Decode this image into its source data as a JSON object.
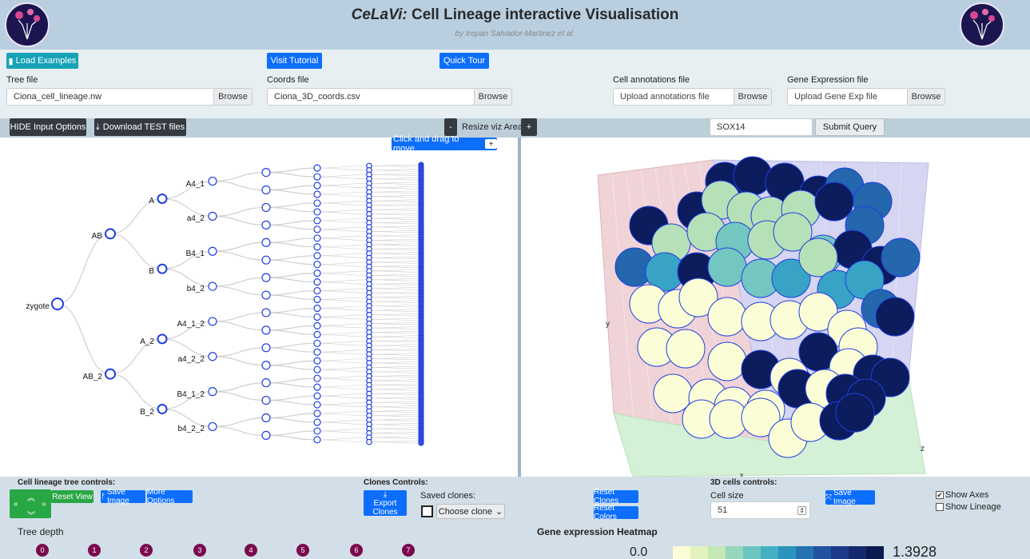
{
  "header": {
    "title_em": "CeLaVi:",
    "title_rest": " Cell Lineage interactive Visualisation",
    "subtitle": "by Irepan Salvador-Martinez et al.",
    "logo_text": "CeLaVi"
  },
  "inputs": {
    "load_examples": "Load Examples",
    "visit_tutorial": "Visit Tutorial",
    "quick_tour": "Quick Tour",
    "tree_file_label": "Tree file",
    "tree_file_value": "Ciona_cell_lineage.nw",
    "coords_file_label": "Coords file",
    "coords_file_value": "Ciona_3D_coords.csv",
    "annotations_label": "Cell annotations file",
    "annotations_placeholder": "Upload annotations file",
    "gene_label": "Gene Expression file",
    "gene_placeholder": "Upload Gene Exp file",
    "browse": "Browse"
  },
  "toolbar": {
    "hide_inputs": "HIDE Input Options",
    "download_test": "Download TEST files",
    "minus": "-",
    "resize_label": "Resize viz Area",
    "plus": "+",
    "gene_query": "SOX14",
    "submit_query": "Submit Query"
  },
  "tree": {
    "drag_label": "Click and drag to move",
    "drag_plus": "+",
    "nodes": {
      "root": "zygote",
      "ab": "AB",
      "ab2": "AB_2",
      "a": "A",
      "b": "B",
      "a2": "A_2",
      "b2": "B_2",
      "a4_1": "A4_1",
      "a4_2": "a4_2",
      "b4_1": "B4_1",
      "b4_2": "b4_2",
      "a4_1_2": "A4_1_2",
      "a4_2_2": "a4_2_2",
      "b4_1_2": "B4_1_2",
      "b4_2_2": "b4_2_2"
    }
  },
  "viz3d": {
    "axis_y": "y",
    "axis_z": "z",
    "axis_x": "x",
    "colors": {
      "pale": "#fbfdd6",
      "light_green": "#b5e0b8",
      "teal": "#74c6c0",
      "mid_blue": "#38a3c5",
      "blue": "#2467ad",
      "dark": "#0c1c5c"
    }
  },
  "controls": {
    "tree_title": "Cell lineage tree controls:",
    "reset_view": "Reset View",
    "save_image": "Save Image",
    "more_options": "More Options",
    "clones_title": "Clones Controls:",
    "export_clones": "Export Clones",
    "saved_clones_label": "Saved clones:",
    "choose_clone": "Choose clone",
    "reset_clones": "Reset Clones",
    "reset_colors": "Reset Colors",
    "cells3d_title": "3D cells controls:",
    "cell_size_label": "Cell size",
    "cell_size_value": "51",
    "save_image_3d": "Save Image",
    "show_axes": "Show Axes",
    "show_lineage": "Show Lineage",
    "tree_depth": "Tree depth",
    "depth_levels": [
      "0",
      "1",
      "2",
      "3",
      "4",
      "5",
      "6",
      "7"
    ],
    "heatmap_title": "Gene expression Heatmap",
    "heatmap_min": "0.0",
    "heatmap_max": "1.3928",
    "heatmap_colors": [
      "#fbfdd6",
      "#e3f3bd",
      "#c4e8b6",
      "#98d6bb",
      "#6cc4bf",
      "#44b0c3",
      "#2c93bd",
      "#2473b0",
      "#21539e",
      "#1d3a8a",
      "#142a6c",
      "#0b1a4f"
    ]
  }
}
